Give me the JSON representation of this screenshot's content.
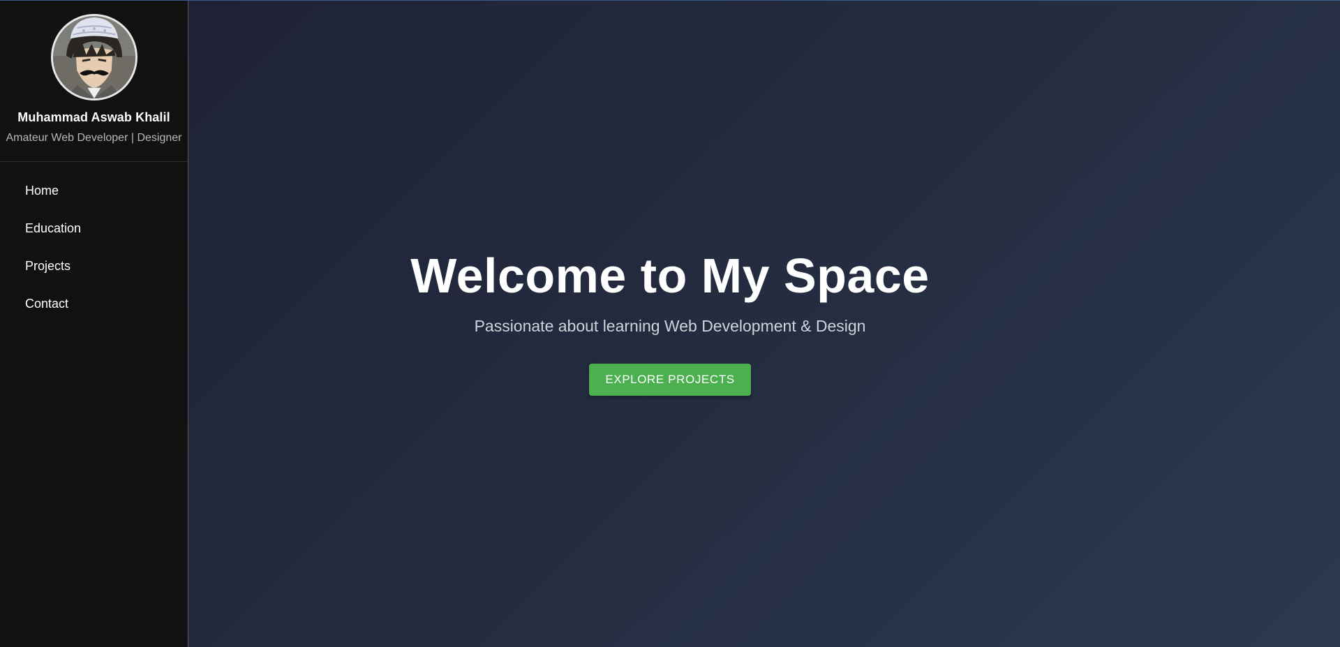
{
  "profile": {
    "name": "Muhammad Aswab Khalil",
    "role": "Amateur Web Developer | Designer"
  },
  "nav": {
    "items": [
      {
        "label": "Home"
      },
      {
        "label": "Education"
      },
      {
        "label": "Projects"
      },
      {
        "label": "Contact"
      }
    ]
  },
  "hero": {
    "title": "Welcome to My Space",
    "subtitle": "Passionate about learning Web Development & Design",
    "button_label": "EXPLORE PROJECTS"
  },
  "colors": {
    "sidebar_bg": "#111111",
    "main_bg_start": "#1f2235",
    "main_bg_end": "#2b3a4f",
    "accent": "#4caf50"
  }
}
